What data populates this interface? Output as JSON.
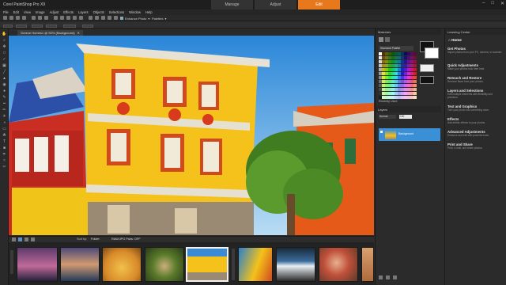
{
  "app": {
    "title": "Corel PaintShop Pro X9"
  },
  "modes": [
    {
      "label": "Manage"
    },
    {
      "label": "Adjust"
    },
    {
      "label": "Edit"
    }
  ],
  "menu": [
    "File",
    "Edit",
    "View",
    "Image",
    "Adjust",
    "Effects",
    "Layers",
    "Objects",
    "Selections",
    "Window",
    "Help"
  ],
  "toolbar": {
    "enhance_label": "Enhance Photo",
    "palettes_label": "Palettes"
  },
  "doc": {
    "tab_label": "Greece Homes1 @ 50% (Background)"
  },
  "panels": {
    "materials": {
      "title": "Materials",
      "palette_name": "Standard Palette"
    },
    "recently_used": "Recently Used",
    "layers": {
      "title": "Layers",
      "blend": "Normal",
      "opacity": "100",
      "layer_name": "Background"
    },
    "learning": {
      "title": "Learning Center",
      "home": "Home",
      "items": [
        {
          "title": "Get Photos",
          "desc": "Import photos from your PC, camera, or scanner."
        },
        {
          "title": "Quick Adjustments",
          "desc": "Make your photos look their best."
        },
        {
          "title": "Retouch and Restore",
          "desc": "Remove flaws from your photos."
        },
        {
          "title": "Layers and Selections",
          "desc": "Edit multiple elements with flexibility and precision."
        },
        {
          "title": "Text and Graphics",
          "desc": "Turn your photo into something more."
        },
        {
          "title": "Effects",
          "desc": "Add artistic effects to your photos."
        },
        {
          "title": "Advanced Adjustments",
          "desc": "Enhance and edit with powerful tools."
        },
        {
          "title": "Print and Share",
          "desc": "Print, e-mail, and share photos."
        }
      ]
    }
  },
  "filmstrip": {
    "sort_label": "Sort by:",
    "sort_value": "Folder",
    "filter_value": "RAW/JPG Pairs: OFF"
  },
  "colors": {
    "accent": "#e8781c",
    "selection": "#3a8fd6"
  }
}
